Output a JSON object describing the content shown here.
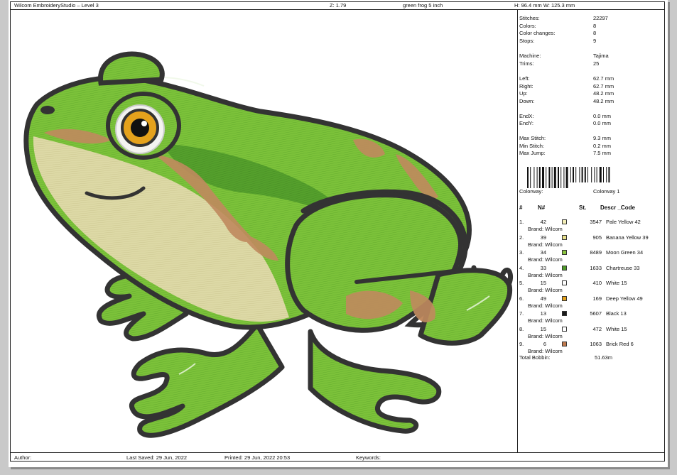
{
  "header": {
    "app_title": "Wilcom EmbroideryStudio – Level 3",
    "zoom": "Z: 1.79",
    "design_name": "green frog 5 inch",
    "size": "H: 96.4 mm   W: 125.3 mm"
  },
  "stats": [
    {
      "label": "Stitches:",
      "value": "22297"
    },
    {
      "label": "Colors:",
      "value": "8"
    },
    {
      "label": "Color changes:",
      "value": "8"
    },
    {
      "label": "Stops:",
      "value": "9"
    },
    {
      "label": "Machine:",
      "value": "Tajima"
    },
    {
      "label": "Trims:",
      "value": "25"
    },
    {
      "label": "Left:",
      "value": "62.7 mm"
    },
    {
      "label": "Right:",
      "value": "62.7 mm"
    },
    {
      "label": "Up:",
      "value": "48.2 mm"
    },
    {
      "label": "Down:",
      "value": "48.2 mm"
    },
    {
      "label": "EndX:",
      "value": "0.0 mm"
    },
    {
      "label": "EndY:",
      "value": "0.0 mm"
    },
    {
      "label": "Max Stitch:",
      "value": "9.3 mm"
    },
    {
      "label": "Min Stitch:",
      "value": "0.2 mm"
    },
    {
      "label": "Max Jump:",
      "value": "7.5 mm"
    }
  ],
  "colorway": {
    "label": "Colorway:",
    "value": "Colorway 1"
  },
  "color_table": {
    "headers": [
      "#",
      "N#",
      "St.",
      "Descr _Code"
    ],
    "rows": [
      {
        "idx": "1.",
        "n": "42",
        "swatch": "#f4efb8",
        "st": "3547",
        "descr": "Pale Yellow 42",
        "brand": "Brand: Wilcom"
      },
      {
        "idx": "2.",
        "n": "39",
        "swatch": "#e8e08a",
        "st": "905",
        "descr": "Banana Yellow 39",
        "brand": "Brand: Wilcom"
      },
      {
        "idx": "3.",
        "n": "34",
        "swatch": "#8cc63f",
        "st": "8489",
        "descr": "Moon Green 34",
        "brand": "Brand: Wilcom"
      },
      {
        "idx": "4.",
        "n": "33",
        "swatch": "#4f9a2a",
        "st": "1633",
        "descr": "Chartreuse 33",
        "brand": "Brand: Wilcom"
      },
      {
        "idx": "5.",
        "n": "15",
        "swatch": "#ffffff",
        "st": "410",
        "descr": "White 15",
        "brand": "Brand: Wilcom"
      },
      {
        "idx": "6.",
        "n": "49",
        "swatch": "#e5a21c",
        "st": "169",
        "descr": "Deep Yellow 49",
        "brand": "Brand: Wilcom"
      },
      {
        "idx": "7.",
        "n": "13",
        "swatch": "#1a1a1a",
        "st": "5607",
        "descr": "Black 13",
        "brand": "Brand: Wilcom"
      },
      {
        "idx": "8.",
        "n": "15",
        "swatch": "#ffffff",
        "st": "472",
        "descr": "White 15",
        "brand": "Brand: Wilcom"
      },
      {
        "idx": "9.",
        "n": "6",
        "swatch": "#c07a4e",
        "st": "1063",
        "descr": "Brick Red 6",
        "brand": "Brand: Wilcom"
      }
    ]
  },
  "total_bobbin": {
    "label": "Total Bobbin:",
    "value": "51.63m"
  },
  "footer": {
    "author": "Author:",
    "last_saved": "Last Saved: 29 Jun, 2022",
    "printed": "Printed: 29 Jun, 2022 20:53",
    "keywords": "Keywords:"
  }
}
